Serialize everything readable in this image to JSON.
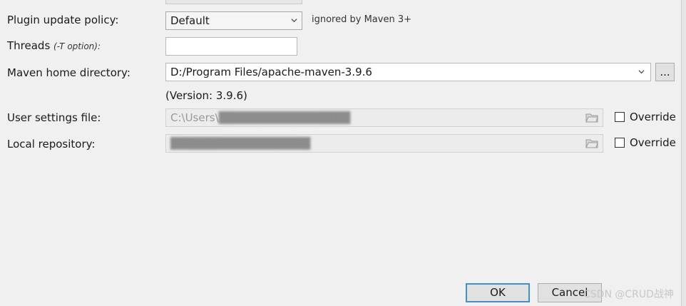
{
  "plugin_update_policy": {
    "label": "Plugin update policy:",
    "value": "Default",
    "note": "ignored by Maven 3+"
  },
  "threads": {
    "label": "Threads",
    "hint": "(-T option):",
    "value": ""
  },
  "maven_home": {
    "label": "Maven home directory:",
    "value": "D:/Program Files/apache-maven-3.9.6",
    "browse_label": "...",
    "version": "(Version: 3.9.6)"
  },
  "user_settings": {
    "label": "User settings file:",
    "value": "C:\\Users\\",
    "override_label": "Override"
  },
  "local_repo": {
    "label": "Local repository:",
    "value": "",
    "override_label": "Override"
  },
  "buttons": {
    "ok": "OK",
    "cancel": "Cancel"
  },
  "watermark": "CSDN @CRUD战神"
}
